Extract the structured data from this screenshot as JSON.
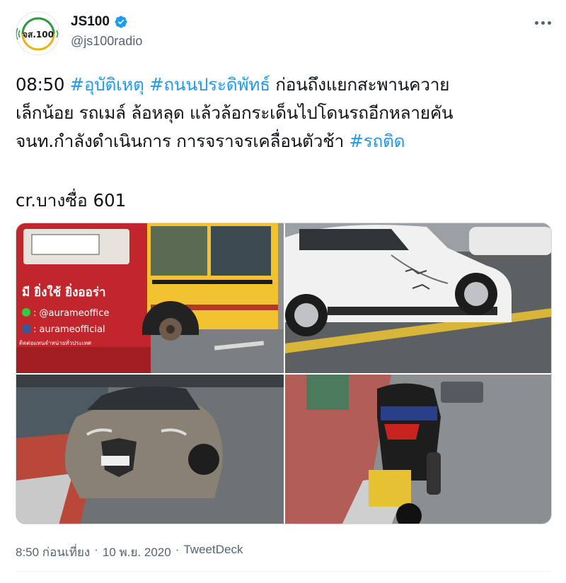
{
  "author": {
    "display_name": "JS100",
    "handle": "@js100radio",
    "avatar_text": "จส.100"
  },
  "tweet": {
    "lines": [
      [
        {
          "text": "08:50 ",
          "hashtag": false
        },
        {
          "text": "#อุบัติเหตุ",
          "hashtag": true
        },
        {
          "text": " ",
          "hashtag": false
        },
        {
          "text": "#ถนนประดิพัทธ์",
          "hashtag": true
        },
        {
          "text": " ก่อนถึงแยกสะพานควาย",
          "hashtag": false
        }
      ],
      [
        {
          "text": "เล็กน้อย รถเมล์ ล้อหลุด แล้วล้อกระเด็นไปโดนรถอีกหลายคัน",
          "hashtag": false
        }
      ],
      [
        {
          "text": "จนท.กำลังดำเนินการ การจราจรเคลื่อนตัวช้า ",
          "hashtag": false
        },
        {
          "text": "#รถติด",
          "hashtag": true
        }
      ]
    ],
    "credit": "cr.บางซื่อ 601"
  },
  "photos": {
    "bus_ad_line1": "มี ยิ่งใช้ ยิ่งออร่า",
    "bus_ad_line_line": ": @aurameoffice",
    "bus_ad_line_fb": ": aurameofficial",
    "bus_ad_line_small": "ติดต่อแทนจำหน่ายทั่วประเทศ"
  },
  "meta": {
    "time": "8:50 ก่อนเที่ยง",
    "separator1": "·",
    "date": "10 พ.ย. 2020",
    "separator2": "·",
    "source": "TweetDeck"
  },
  "colors": {
    "hashtag": "#1d9bf0",
    "verified": "#1d9bf0",
    "secondary_text": "#536471"
  },
  "icons": [
    "verified-badge-icon",
    "more-options-icon"
  ]
}
